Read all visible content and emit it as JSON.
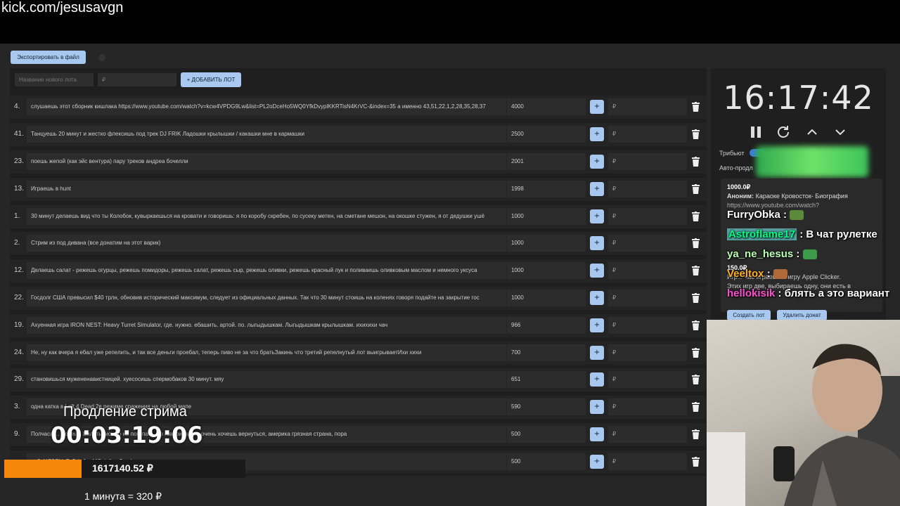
{
  "browser": {
    "url": "kick.com/jesusavgn"
  },
  "toolbar": {
    "export_label": "Экспортировать в файл"
  },
  "new_lot": {
    "name_placeholder": "Название нового лота",
    "price_placeholder": "₽",
    "add_label": "+ ДОБАВИТЬ ЛОТ"
  },
  "lots": [
    {
      "index": "4.",
      "title": "слушаешь этот сборник кишлака https://www.youtube.com/watch?v=kcw4VPDG9Lw&list=PL2oDceHo5WQ0YfkDvyplKKRTisN4KrVC-&index=35 а именно 43,51,22,1,2,28,35,28,37",
      "amount": "4000",
      "plus": "+",
      "currency": "₽"
    },
    {
      "index": "41.",
      "title": "Танцуешь 20 минут и жестко флексишь под трек DJ FRIK Ладошки крылышки / какашки мне в кармашки",
      "amount": "2500",
      "plus": "+",
      "currency": "₽"
    },
    {
      "index": "23.",
      "title": "поешь жепой (как эйс вентура) пару треков андреа бочелли",
      "amount": "2001",
      "plus": "+",
      "currency": "₽"
    },
    {
      "index": "13.",
      "title": "Играешь в hunt",
      "amount": "1998",
      "plus": "+",
      "currency": "₽"
    },
    {
      "index": "1.",
      "title": "30 минут делаешь вид что ты Колобок, кувыркаешься на кровати и говоришь: я по коробу скребен, по сусеку метен, на сметане мешон, на окошке стужен, я от дедушки ушё",
      "amount": "1000",
      "plus": "+",
      "currency": "₽"
    },
    {
      "index": "2.",
      "title": "Стрим из под дивана (все донатим на этот варик)",
      "amount": "1000",
      "plus": "+",
      "currency": "₽"
    },
    {
      "index": "12.",
      "title": "Делаешь салат - режешь огурцы, режешь помидоры, режешь салат, режешь сыр, режешь оливки, режешь красный лук и поливаешь оливковым маслом и немного уксуса",
      "amount": "1000",
      "plus": "+",
      "currency": "₽"
    },
    {
      "index": "22.",
      "title": "Госдолг США превысил $40 трлн, обновив исторический максимум, следует из официальных данных. Так что 30 минут стоишь на коленях говоря подайте на закрытие гос",
      "amount": "1000",
      "plus": "+",
      "currency": "₽"
    },
    {
      "index": "19.",
      "title": "Ахуенная игра IRON NEST: Heavy Turret Simulator, где. нужно. ебашить. артой. по. лыгыдышкам. Лыгыдышкам крылышкам. ихихихи чач",
      "amount": "966",
      "plus": "+",
      "currency": "₽"
    },
    {
      "index": "24.",
      "title": "Не, ну как вчера я ебал уже репелить, и так все деньги проебал, теперь пиво не за что братьЗакинь что третий репелнутый лот выигрываетИхи хихи",
      "amount": "700",
      "plus": "+",
      "currency": "₽"
    },
    {
      "index": "29.",
      "title": "становишься мужененавистницей. хуесосишь спермобаков 30 минут. мяу",
      "amount": "651",
      "plus": "+",
      "currency": "₽"
    },
    {
      "index": "3.",
      "title": "одна катка в Left 4 Dead 2в режиме сражения на любой мапе",
      "amount": "590",
      "plus": "+",
      "currency": "₽"
    },
    {
      "index": "9.",
      "title": "Полчаса ... Донецк. Билеты можно не покупать, но говоришь что очень хочешь вернуться, америка грязная страна, пора",
      "amount": "500",
      "plus": "+",
      "currency": "₽"
    },
    {
      "index": "",
      "title": "... 6gUC9Cbjz7o?si=AqcMOqinlhax2uud",
      "amount": "500",
      "plus": "+",
      "currency": "₽"
    }
  ],
  "timer": {
    "time": "16:17:42"
  },
  "settings": {
    "tribute_label": "Трибьют",
    "autoextend_label": "Авто-продл"
  },
  "donations": [
    {
      "amount": "1000.0₽",
      "name": "Аноним:",
      "text": "Караоке Кровосток- Биография",
      "url": "https://www.youtube.com/watch?"
    },
    {
      "amount": "150.0₽",
      "text": "Игр... час играешь в игру Apple Clicker.",
      "text2": "Этих игр две, выбираешь одну, они есть в"
    }
  ],
  "lot_buttons": {
    "create": "Создать лот",
    "delete": "Удалить донат"
  },
  "chat": [
    {
      "user": "FurryObka",
      "sep": " : ",
      "message": ""
    },
    {
      "user": "Astroflame17",
      "sep": " : ",
      "message": "В чат рулетке"
    },
    {
      "user": "ya_ne_hesus",
      "sep": " : ",
      "message": ""
    },
    {
      "user": "Veeltox",
      "sep": " : ",
      "message": ""
    },
    {
      "user": "hellokisik",
      "sep": " : ",
      "message": "блять а это вариант"
    }
  ],
  "overlay": {
    "label": "Продление стрима",
    "time": "00:03:19:06",
    "total": "1617140.52 ₽",
    "rate": "1 минута = 320 ₽",
    "accent": "#f5870a"
  }
}
